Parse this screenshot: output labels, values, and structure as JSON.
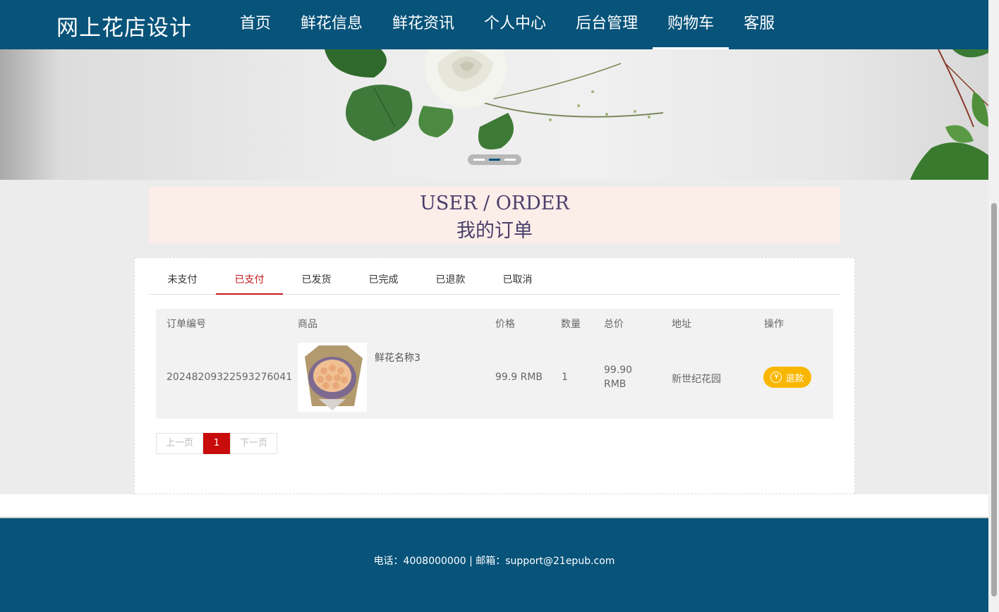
{
  "header": {
    "brand": "网上花店设计",
    "nav": [
      "首页",
      "鲜花信息",
      "鲜花资讯",
      "个人中心",
      "后台管理",
      "购物车",
      "客服"
    ],
    "active_nav": "购物车"
  },
  "banner": {
    "slide_count": 3,
    "active_slide": 2
  },
  "page_title": {
    "en": "USER / ORDER",
    "cn": "我的订单"
  },
  "tabs": [
    "未支付",
    "已支付",
    "已发货",
    "已完成",
    "已退款",
    "已取消"
  ],
  "active_tab": "已支付",
  "table": {
    "headers": [
      "订单编号",
      "商品",
      "价格",
      "数量",
      "总价",
      "地址",
      "操作"
    ],
    "rows": [
      {
        "order_no": "20248209322593276041",
        "product_name": "鲜花名称3",
        "price": "99.9 RMB",
        "qty": "1",
        "total_amount": "99.90",
        "total_unit": "RMB",
        "address": "新世纪花园",
        "action": "退款"
      }
    ]
  },
  "pager": {
    "prev": "上一页",
    "current": "1",
    "next": "下一页"
  },
  "footer": {
    "text": "电话：4008000000 | 邮箱：support@21epub.com"
  },
  "colors": {
    "header_bg": "#07537a",
    "accent_red": "#c51b1b",
    "refund_btn": "#f9b600"
  },
  "icons": {
    "refund": "yen-icon"
  }
}
